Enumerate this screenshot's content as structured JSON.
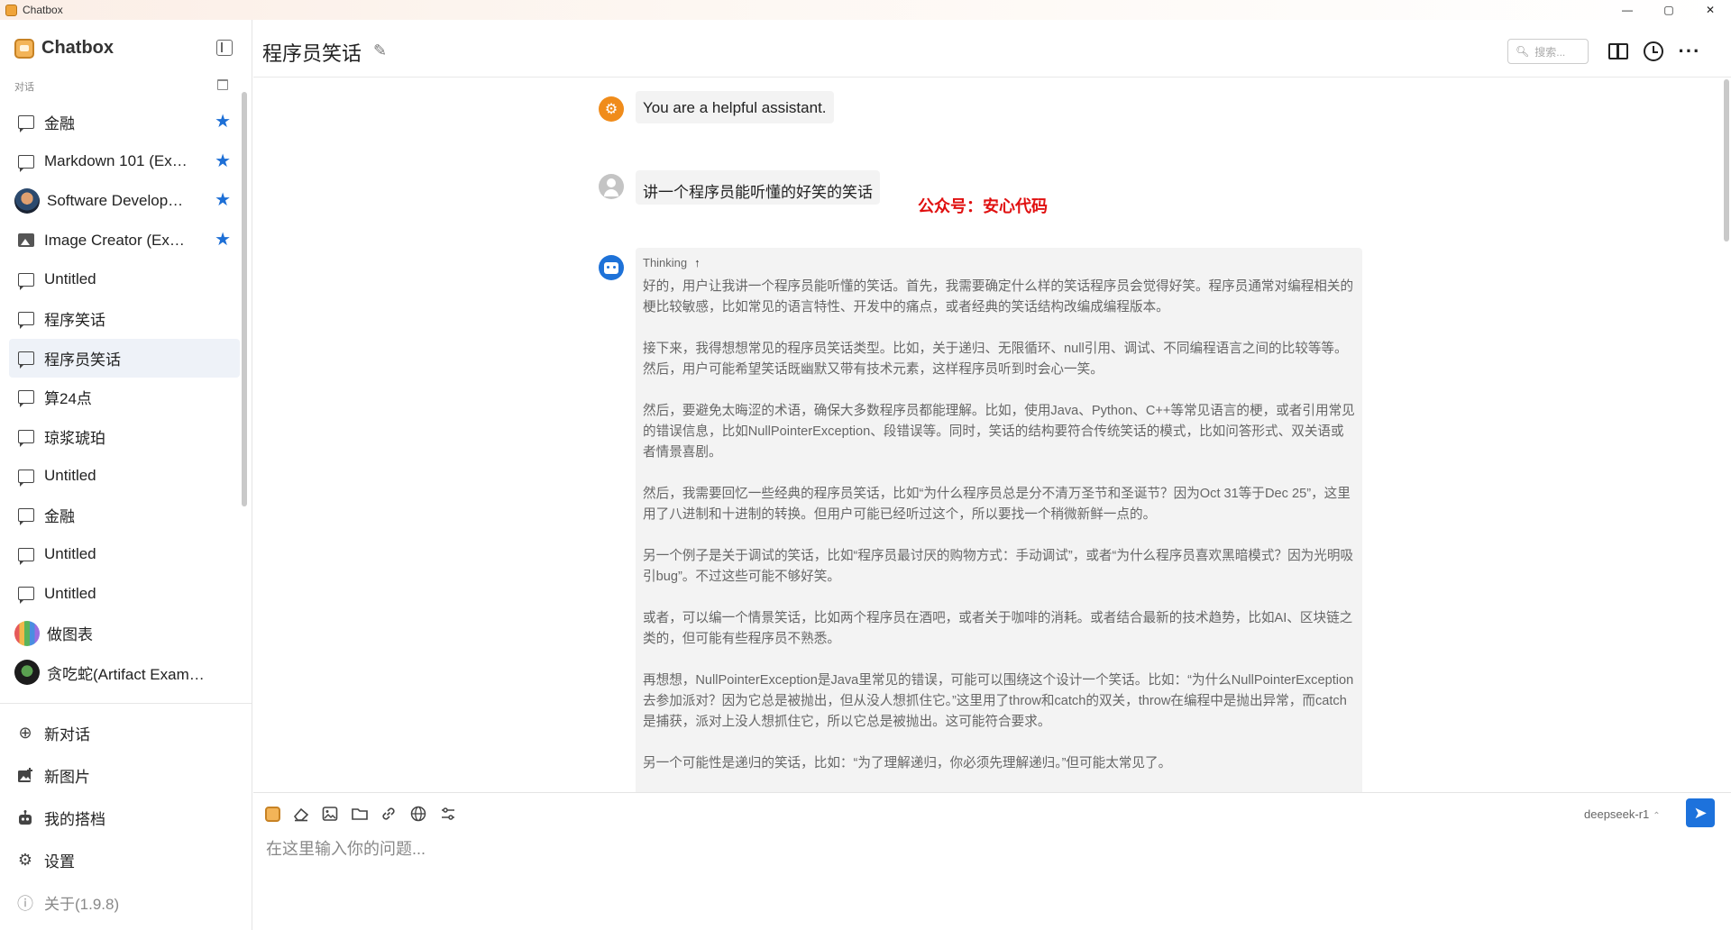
{
  "window": {
    "title": "Chatbox",
    "controls": [
      "—",
      "▢",
      "✕"
    ]
  },
  "sidebar": {
    "brand": "Chatbox",
    "section_label": "对话",
    "sessions": [
      {
        "label": "金融",
        "icon": "chat-icon",
        "starred": true,
        "active": false
      },
      {
        "label": "Markdown 101 (Ex…",
        "icon": "chat-icon",
        "starred": true,
        "active": false
      },
      {
        "label": "Software Develop…",
        "icon": "avatar-image",
        "starred": true,
        "active": false
      },
      {
        "label": "Image Creator (Ex…",
        "icon": "image-icon",
        "starred": true,
        "active": false
      },
      {
        "label": "Untitled",
        "icon": "chat-icon",
        "starred": false,
        "active": false
      },
      {
        "label": "程序笑话",
        "icon": "chat-icon",
        "starred": false,
        "active": false
      },
      {
        "label": "程序员笑话",
        "icon": "chat-icon",
        "starred": false,
        "active": true
      },
      {
        "label": "算24点",
        "icon": "chat-icon",
        "starred": false,
        "active": false
      },
      {
        "label": "琼浆琥珀",
        "icon": "chat-icon",
        "starred": false,
        "active": false
      },
      {
        "label": "Untitled",
        "icon": "chat-icon",
        "starred": false,
        "active": false
      },
      {
        "label": "金融",
        "icon": "chat-icon",
        "starred": false,
        "active": false
      },
      {
        "label": "Untitled",
        "icon": "chat-icon",
        "starred": false,
        "active": false
      },
      {
        "label": "Untitled",
        "icon": "chat-icon",
        "starred": false,
        "active": false
      },
      {
        "label": "做图表",
        "icon": "chart-avatar",
        "starred": false,
        "active": false
      },
      {
        "label": "贪吃蛇(Artifact Example)",
        "icon": "snake-avatar",
        "starred": false,
        "active": false
      }
    ],
    "actions": {
      "new_chat": "新对话",
      "new_image": "新图片",
      "my_partners": "我的搭档",
      "settings": "设置",
      "about": "关于(1.9.8)"
    }
  },
  "header": {
    "title": "程序员笑话",
    "search_placeholder": "搜索..."
  },
  "messages": {
    "system": "You are a helpful assistant.",
    "user": "讲一个程序员能听懂的好笑的笑话",
    "watermark": "公众号：安心代码",
    "thinking_label": "Thinking",
    "thinking_paragraphs": [
      "好的，用户让我讲一个程序员能听懂的笑话。首先，我需要确定什么样的笑话程序员会觉得好笑。程序员通常对编程相关的梗比较敏感，比如常见的语言特性、开发中的痛点，或者经典的笑话结构改编成编程版本。",
      "接下来，我得想想常见的程序员笑话类型。比如，关于递归、无限循环、null引用、调试、不同编程语言之间的比较等等。然后，用户可能希望笑话既幽默又带有技术元素，这样程序员听到时会心一笑。",
      "然后，要避免太晦涩的术语，确保大多数程序员都能理解。比如，使用Java、Python、C++等常见语言的梗，或者引用常见的错误信息，比如NullPointerException、段错误等。同时，笑话的结构要符合传统笑话的模式，比如问答形式、双关语或者情景喜剧。",
      "然后，我需要回忆一些经典的程序员笑话，比如“为什么程序员总是分不清万圣节和圣诞节？因为Oct 31等于Dec 25”，这里用了八进制和十进制的转换。但用户可能已经听过这个，所以要找一个稍微新鲜一点的。",
      "另一个例子是关于调试的笑话，比如“程序员最讨厌的购物方式：手动调试”，或者“为什么程序员喜欢黑暗模式？因为光明吸引bug”。不过这些可能不够好笑。",
      "或者，可以编一个情景笑话，比如两个程序员在酒吧，或者关于咖啡的消耗。或者结合最新的技术趋势，比如AI、区块链之类的，但可能有些程序员不熟悉。",
      "再想想，NullPointerException是Java里常见的错误，可能可以围绕这个设计一个笑话。比如：“为什么NullPointerException去参加派对？因为它总是被抛出，但从没人想抓住它。”这里用了throw和catch的双关，throw在编程中是抛出异常，而catch是捕获，派对上没人想抓住它，所以它总是被抛出。这可能符合要求。",
      "另一个可能性是递归的笑话，比如：“为了理解递归，你必须先理解递归。”但可能太常见了。"
    ]
  },
  "input": {
    "placeholder": "在这里输入你的问题...",
    "model": "deepseek-r1"
  },
  "colors": {
    "accent": "#1d72dc",
    "star": "#1d6fd6",
    "watermark": "#e01010",
    "system_avatar": "#f08c1b"
  }
}
